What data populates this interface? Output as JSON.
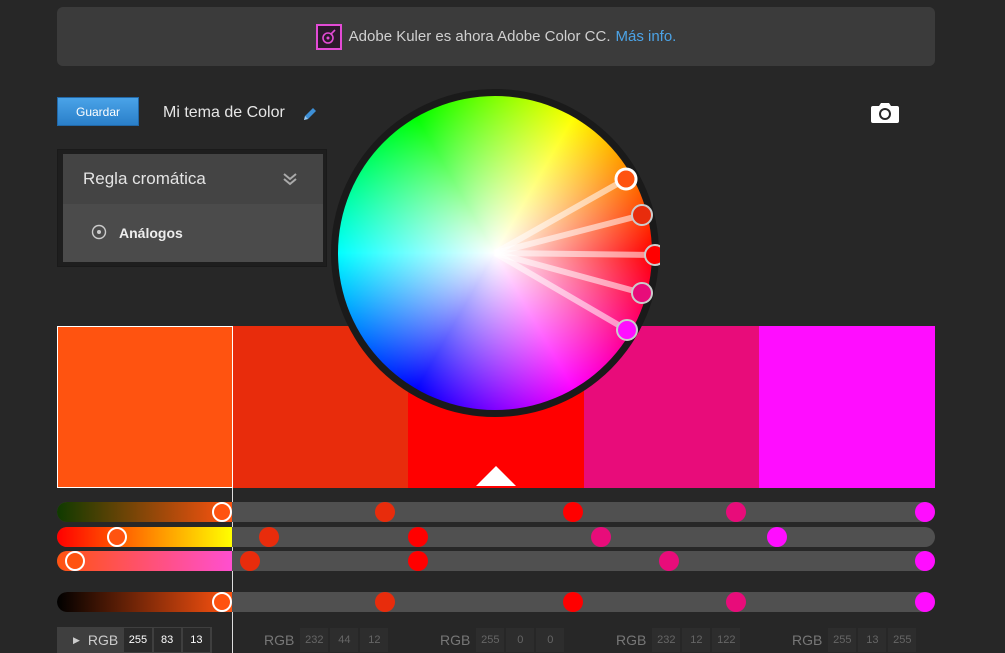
{
  "banner": {
    "text": "Adobe Kuler es ahora Adobe Color CC.",
    "link": "Más info."
  },
  "toolbar": {
    "save_label": "Guardar",
    "theme_title": "Mi tema de Color"
  },
  "rule_panel": {
    "title": "Regla cromática",
    "selected_rule": "Análogos"
  },
  "swatches": [
    {
      "color": "#ff5310"
    },
    {
      "color": "#e82c0c"
    },
    {
      "color": "#ff0000"
    },
    {
      "color": "#e80c7a"
    },
    {
      "color": "#ff0dff"
    }
  ],
  "selected_index": 0,
  "rgb_label": "RGB",
  "rgb_values": [
    {
      "r": "255",
      "g": "83",
      "b": "13"
    },
    {
      "r": "232",
      "g": "44",
      "b": "12"
    },
    {
      "r": "255",
      "g": "0",
      "b": "0"
    },
    {
      "r": "232",
      "g": "12",
      "b": "122"
    },
    {
      "r": "255",
      "g": "13",
      "b": "255"
    }
  ],
  "icons": {
    "banner_logo": "adobe-color-logo-icon",
    "edit": "pencil-icon",
    "camera": "camera-icon",
    "collapse": "double-chevron-down-icon",
    "rule_radio": "radio-icon",
    "expand_row": "triangle-right-icon"
  }
}
